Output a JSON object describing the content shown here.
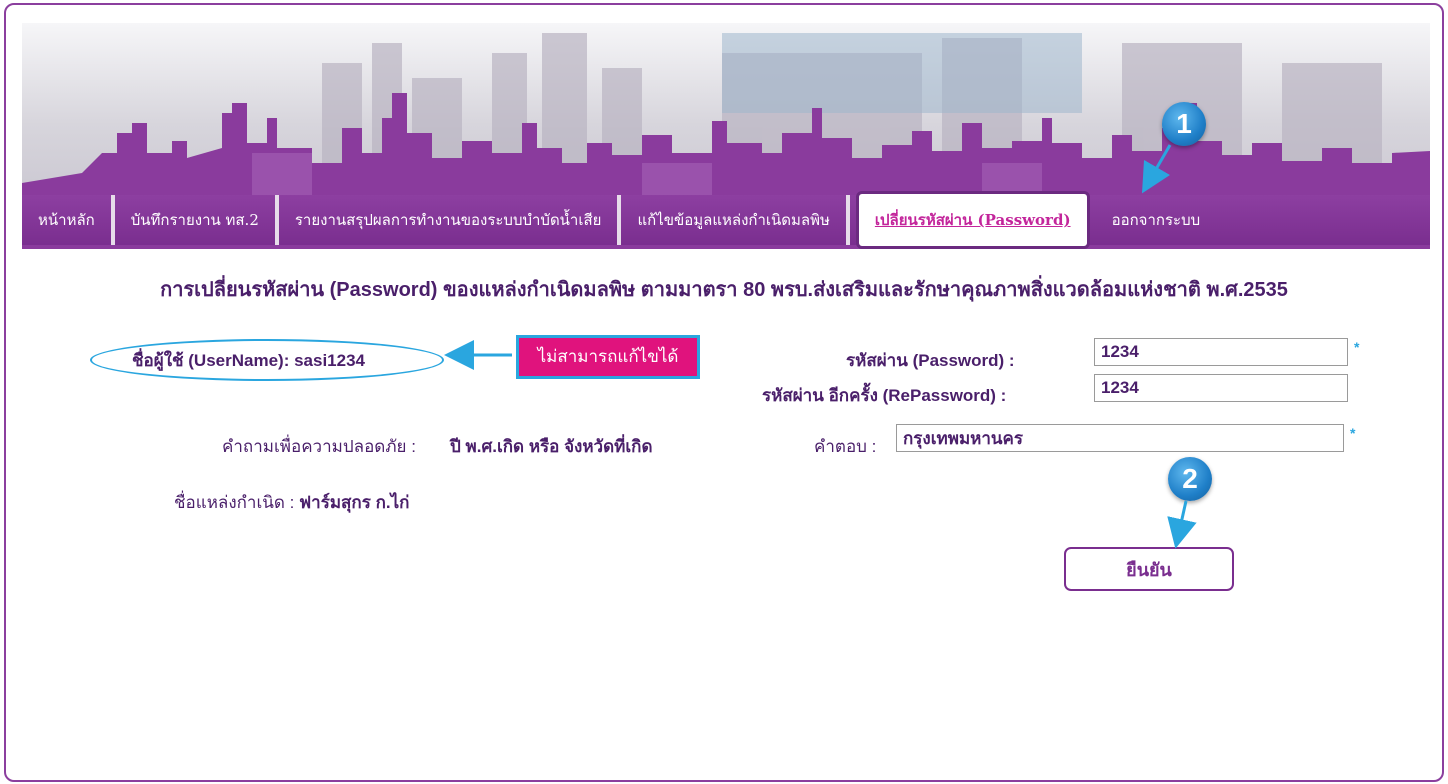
{
  "nav": {
    "items": [
      {
        "label": "หน้าหลัก"
      },
      {
        "label": "บันทึกรายงาน ทส.2"
      },
      {
        "label": "รายงานสรุปผลการทำงานของระบบบำบัดน้ำเสีย"
      },
      {
        "label": "แก้ไขข้อมูลแหล่งกำเนิดมลพิษ"
      },
      {
        "label": "เปลี่ยนรหัสผ่าน (Password)",
        "active": true
      },
      {
        "label": "ออกจากระบบ"
      }
    ]
  },
  "page": {
    "title": "การเปลี่ยนรหัสผ่าน (Password) ของแหล่งกำเนิดมลพิษ ตามมาตรา 80 พรบ.ส่งเสริมและรักษาคุณภาพสิ่งแวดล้อมแห่งชาติ พ.ศ.2535"
  },
  "form": {
    "username_label": "ชื่อผู้ใช้ (UserName):",
    "username_value": "sasi1234",
    "note": "ไม่สามารถแก้ไขได้",
    "password_label": "รหัสผ่าน (Password) :",
    "password_value": "1234",
    "repassword_label": "รหัสผ่าน อีกครั้ง (RePassword) :",
    "repassword_value": "1234",
    "question_label": "คำถามเพื่อความปลอดภัย :",
    "question_value": "ปี พ.ศ.เกิด หรือ จังหวัดที่เกิด",
    "answer_label": "คำตอบ :",
    "answer_value": "กรุงเทพมหานคร",
    "source_label": "ชื่อแหล่งกำเนิด :",
    "source_value": "ฟาร์มสุกร ก.ไก่",
    "required_mark": "*",
    "confirm_label": "ยืนยัน"
  },
  "annotations": {
    "step1": "1",
    "step2": "2"
  },
  "colors": {
    "nav_bg": "#7a2e8f",
    "title_text": "#4a1f6a",
    "badge_bg": "#e0137d",
    "accent_blue": "#2aa6df"
  }
}
